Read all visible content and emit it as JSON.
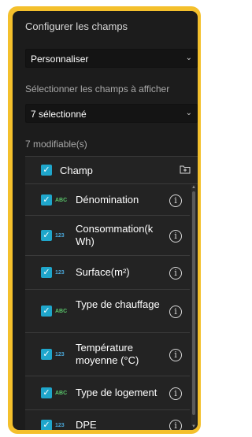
{
  "title": "Configurer les champs",
  "mode_select": {
    "value": "Personnaliser"
  },
  "fields_label": "Sélectionner les champs à afficher",
  "fields_select": {
    "value": "7 sélectionné"
  },
  "editable_label": "7 modifiable(s)",
  "header": {
    "label": "Champ"
  },
  "fields": [
    {
      "type": "ABC",
      "name": "Dénomination"
    },
    {
      "type": "123",
      "name": "Consommation(k Wh)"
    },
    {
      "type": "123",
      "name": "Surface(m²)"
    },
    {
      "type": "ABC",
      "name": "Type de chauffage"
    },
    {
      "type": "123",
      "name": "Température moyenne (°C)"
    },
    {
      "type": "ABC",
      "name": "Type de logement"
    },
    {
      "type": "123",
      "name": "DPE"
    }
  ],
  "colors": {
    "accent": "#1fa6cb",
    "frame": "#f4c02c",
    "text_type": "#59c46a",
    "num_type": "#4aa7d9"
  }
}
